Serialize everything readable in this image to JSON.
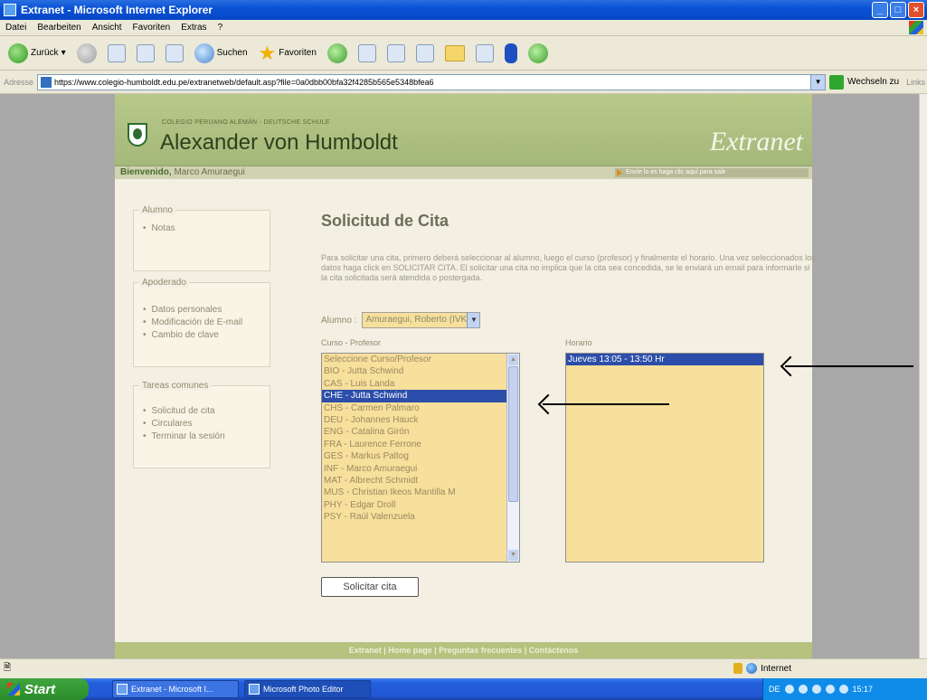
{
  "window": {
    "title": "Extranet - Microsoft Internet Explorer",
    "buttons": [
      "_",
      "□",
      "×"
    ]
  },
  "menu": [
    "Datei",
    "Bearbeiten",
    "Ansicht",
    "Favoriten",
    "Extras",
    "?"
  ],
  "toolbar": {
    "back_label": "Zurück",
    "search_label": "Suchen",
    "favorites_label": "Favoriten"
  },
  "address": {
    "label": "Adresse",
    "url": "https://www.colegio-humboldt.edu.pe/extranetweb/default.asp?file=0a0dbb00bfa32f4285b565e5348bfea6",
    "go_label": "Wechseln zu",
    "links_label": "Links"
  },
  "site": {
    "school_subtitle": "COLEGIO PERUANO ALEMÁN - DEUTSCHE SCHULE",
    "school_name": "Alexander von Humboldt",
    "extranet": "Extranet",
    "welcome_prefix": "Bienvenido,",
    "welcome_name": "Marco Amuraegui",
    "welcome_right": "Envíe lo es haga clic aquí para salir"
  },
  "sidebar": {
    "groups": [
      {
        "title": "Alumno",
        "items": [
          "Notas"
        ]
      },
      {
        "title": "Apoderado",
        "items": [
          "Datos personales",
          "Modificación de E-mail",
          "Cambio de clave"
        ]
      },
      {
        "title": "Tareas comunes",
        "items": [
          "Solicitud de cita",
          "Circulares",
          "Terminar la sesión"
        ]
      }
    ]
  },
  "content": {
    "title": "Solicitud de Cita",
    "intro": "Para solicitar una cita, primero deberá seleccionar al alumno, luego el curso (profesor) y finalmente el horario. Una vez seleccionados los datos haga click en SOLICITAR CITA. El solicitar una cita no implica que la cita sea concedida, se le enviará un email para informarle si la cita solicitada será atendida o postergada.",
    "alumno_label": "Alumno :",
    "alumno_value": "Amuraegui, Roberto (IVKf)",
    "curso_label": "Curso - Profesor",
    "horario_label": "Horario",
    "cursos": [
      "Seleccione Curso/Profesor",
      "BIO - Jutta Schwind",
      "CAS - Luis Landa",
      "CHE - Jutta Schwind",
      "CHS - Carmen Palmaro",
      "DEU - Johannes Hauck",
      "ENG - Catalina Girón",
      "FRA - Laurence Ferrone",
      "GES - Markus Paltog",
      "INF - Marco Amuraegui",
      "MAT - Albrecht Schmidt",
      "MUS - Christian Ikeos Mantilla M",
      "PHY - Edgar Droll",
      "PSY - Raúl Valenzuela"
    ],
    "curso_selected": "CHE - Jutta Schwind",
    "horarios": [
      "Jueves 13:05 - 13:50 Hr"
    ],
    "horario_selected": "Jueves 13:05 - 13:50 Hr",
    "button": "Solicitar cita"
  },
  "footer": "Extranet | Home page | Preguntas frecuentes | Contáctenos",
  "status": {
    "zone": "Internet"
  },
  "taskbar": {
    "start": "Start",
    "items": [
      "Extranet - Microsoft I...",
      "Microsoft Photo Editor"
    ],
    "tray_lang": "DE",
    "clock": "15:17"
  }
}
